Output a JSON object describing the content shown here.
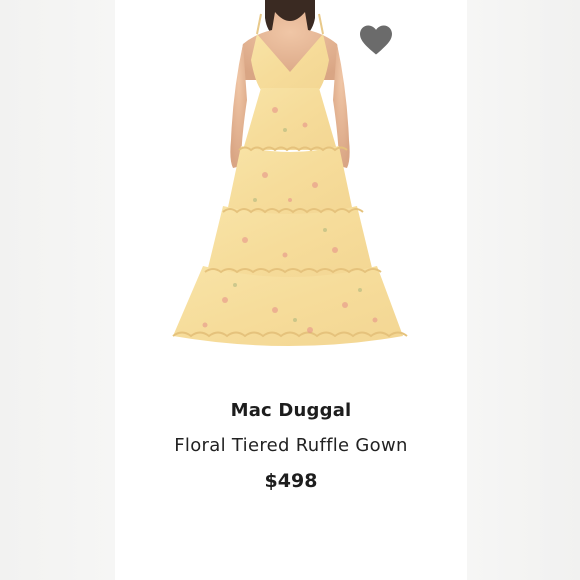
{
  "product": {
    "image_icon": "dress-photo",
    "favorite_icon": "heart-icon",
    "favorite_color": "#6b6b6b",
    "brand": "Mac Duggal",
    "title": "Floral Tiered Ruffle Gown",
    "price": "$498"
  }
}
